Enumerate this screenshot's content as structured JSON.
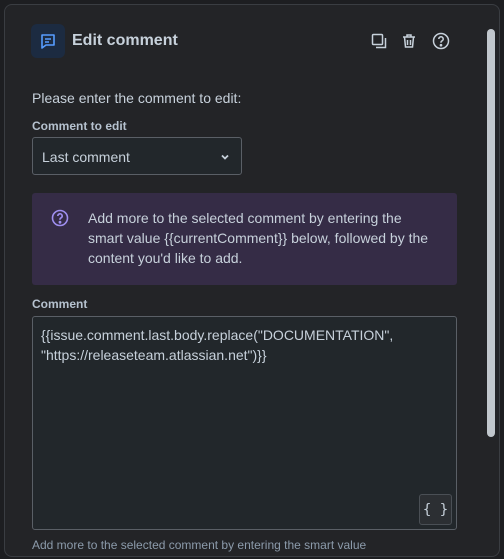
{
  "header": {
    "title": "Edit comment",
    "icons": [
      "comment-icon",
      "duplicate-icon",
      "trash-icon",
      "help-icon"
    ]
  },
  "intro": "Please enter the comment to edit:",
  "comment_to_edit": {
    "label": "Comment to edit",
    "selected": "Last comment"
  },
  "info_panel": {
    "text": "Add more to the selected comment by entering the smart value {{currentComment}} below, followed by the content you'd like to add."
  },
  "comment": {
    "label": "Comment",
    "value": "{{issue.comment.last.body.replace(\"DOCUMENTATION\", \"https://releaseteam.atlassian.net\")}}",
    "smart_value_button": "{ }"
  },
  "helper_text": "Add more to the selected comment by entering the smart value",
  "colors": {
    "accent_blue": "#579dff",
    "discovery_purple": "#9f8fef",
    "info_bg": "#352c46"
  }
}
